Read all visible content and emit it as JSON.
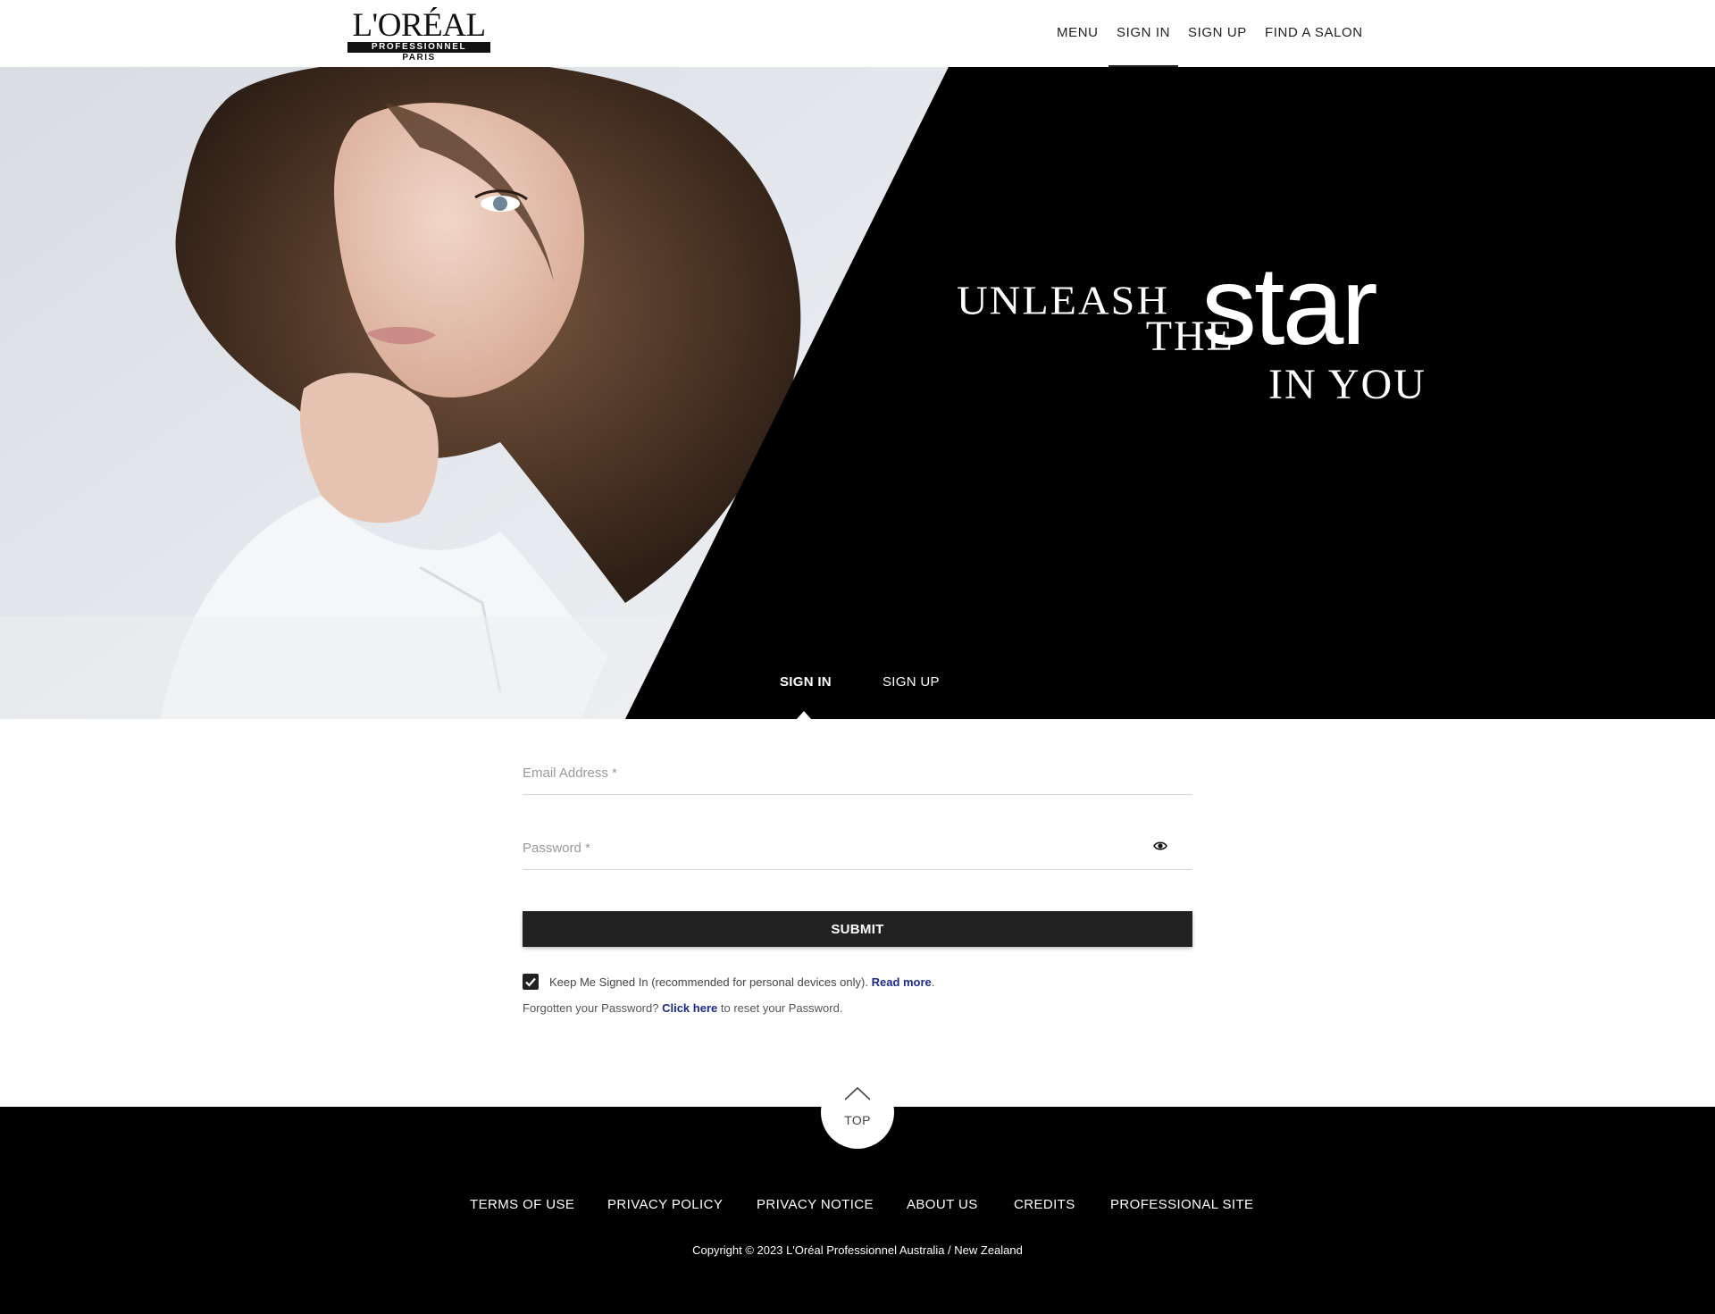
{
  "brand": {
    "logo_word": "L'ORÉAL",
    "logo_bar": "PROFESSIONNEL",
    "logo_city": "PARIS"
  },
  "nav": {
    "items": [
      {
        "label": "MENU"
      },
      {
        "label": "SIGN IN",
        "active": true
      },
      {
        "label": "SIGN UP"
      },
      {
        "label": "FIND A SALON"
      }
    ]
  },
  "hero": {
    "tagline": {
      "line1": "UNLEASH",
      "line2": "THE",
      "highlight": "star",
      "line3": "IN YOU"
    },
    "tabs": [
      {
        "label": "SIGN IN",
        "active": true
      },
      {
        "label": "SIGN UP"
      }
    ]
  },
  "form": {
    "email": {
      "value": "",
      "placeholder": "Email Address *"
    },
    "password": {
      "value": "",
      "placeholder": "Password *",
      "icon": "eye-icon"
    },
    "submit_label": "SUBMIT",
    "keep_signed_in": {
      "checked": true,
      "text": "Keep Me Signed In (recommended for personal devices only).",
      "link": "Read more",
      "suffix": "."
    },
    "forgot": {
      "prefix": "Forgotten your Password?",
      "link": "Click here",
      "suffix": "to reset your Password."
    }
  },
  "footer": {
    "top_label": "TOP",
    "links": [
      {
        "label": "TERMS OF USE"
      },
      {
        "label": "PRIVACY POLICY"
      },
      {
        "label": "PRIVACY NOTICE"
      },
      {
        "label": "ABOUT US"
      },
      {
        "label": "CREDITS"
      },
      {
        "label": "PROFESSIONAL SITE"
      }
    ],
    "copyright": "Copyright © 2023 L'Oréal Professionnel Australia / New Zealand"
  },
  "colors": {
    "black": "#000000",
    "button": "#222222",
    "link": "#1a2a8a",
    "hero_light": "#dfe3e8"
  }
}
